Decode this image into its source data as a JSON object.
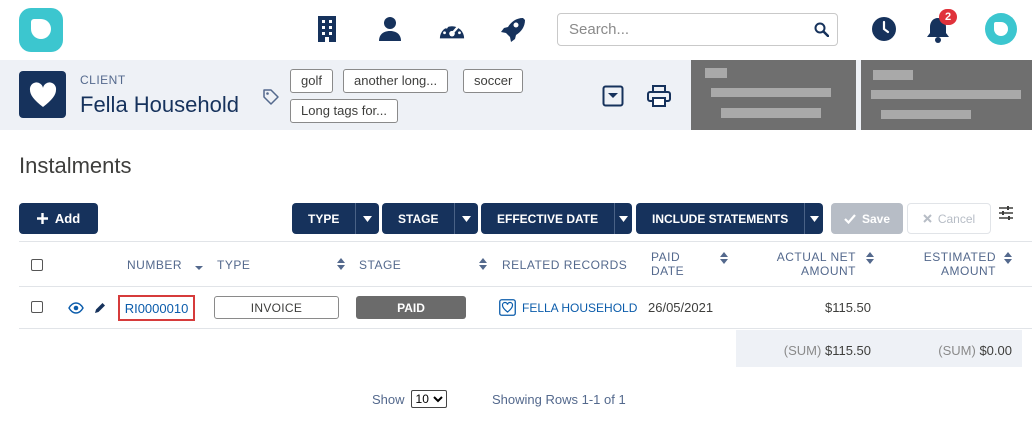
{
  "nav": {
    "search_placeholder": "Search...",
    "notification_count": "2",
    "icons": [
      "building-icon",
      "person-icon",
      "dashboard-icon",
      "rocket-icon",
      "clock-icon",
      "bell-icon"
    ]
  },
  "record": {
    "object_label": "CLIENT",
    "title": "Fella Household",
    "tags": [
      "golf",
      "another long...",
      "soccer",
      "Long tags for..."
    ]
  },
  "page": {
    "title": "Instalments"
  },
  "toolbar": {
    "add_label": "Add",
    "filters": [
      "TYPE",
      "STAGE",
      "EFFECTIVE DATE",
      "INCLUDE STATEMENTS"
    ],
    "save_label": "Save",
    "cancel_label": "Cancel"
  },
  "table": {
    "columns": {
      "number": "NUMBER",
      "type": "TYPE",
      "stage": "STAGE",
      "related": "RELATED RECORDS",
      "paid_date_1": "PAID",
      "paid_date_2": "DATE",
      "actual_1": "ACTUAL NET",
      "actual_2": "AMOUNT",
      "estimated_1": "ESTIMATED",
      "estimated_2": "AMOUNT"
    },
    "rows": [
      {
        "number": "RI0000010",
        "type": "INVOICE",
        "stage": "PAID",
        "related": "FELLA HOUSEHOLD",
        "paid_date": "26/05/2021",
        "actual_net_amount": "$115.50",
        "estimated_amount": ""
      }
    ],
    "summary": {
      "sum_label": "(SUM)",
      "actual_sum": "$115.50",
      "estimated_sum": "$0.00"
    }
  },
  "footer": {
    "show_label": "Show",
    "page_size": "10",
    "rows_info": "Showing Rows 1-1 of 1"
  },
  "colors": {
    "primary": "#16325c",
    "accent": "#3cc6cf",
    "link": "#0b5cab",
    "badge": "#e0323b"
  }
}
